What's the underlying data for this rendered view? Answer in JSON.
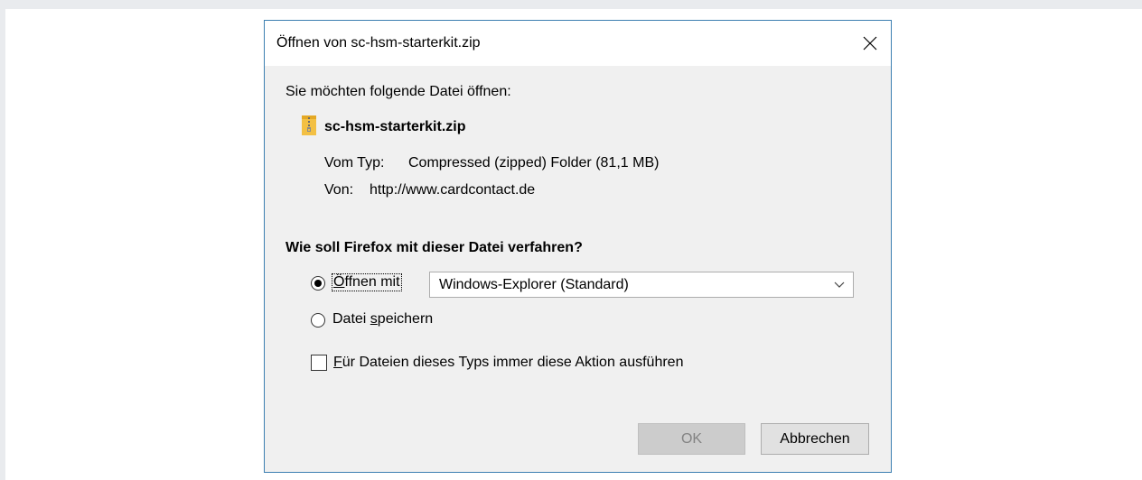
{
  "dialog": {
    "title": "Öffnen von sc-hsm-starterkit.zip",
    "prompt": "Sie möchten folgende Datei öffnen:",
    "file": {
      "name": "sc-hsm-starterkit.zip",
      "icon": "zip-folder-icon",
      "type_label": "Vom Typ:",
      "type_value": "Compressed (zipped) Folder (81,1 MB)",
      "from_label": "Von:",
      "from_value": "http://www.cardcontact.de"
    },
    "question": "Wie soll Firefox mit dieser Datei verfahren?",
    "options": {
      "open_with": {
        "label_prefix": "",
        "label_access_key": "Ö",
        "label_rest": "ffnen mit",
        "selected": true
      },
      "save": {
        "label_prefix": "Datei ",
        "label_access_key": "s",
        "label_rest": "peichern",
        "selected": false
      }
    },
    "app_select": {
      "value": "Windows-Explorer (Standard)"
    },
    "remember": {
      "label_access_key": "F",
      "label_rest": "ür Dateien dieses Typs immer diese Aktion ausführen",
      "checked": false
    },
    "buttons": {
      "ok": "OK",
      "cancel": "Abbrechen"
    }
  },
  "colors": {
    "page_background": "#e9ebee",
    "dialog_border": "#3c7fb1",
    "dialog_body": "#f0f0f0",
    "ok_disabled_text": "#838383"
  }
}
